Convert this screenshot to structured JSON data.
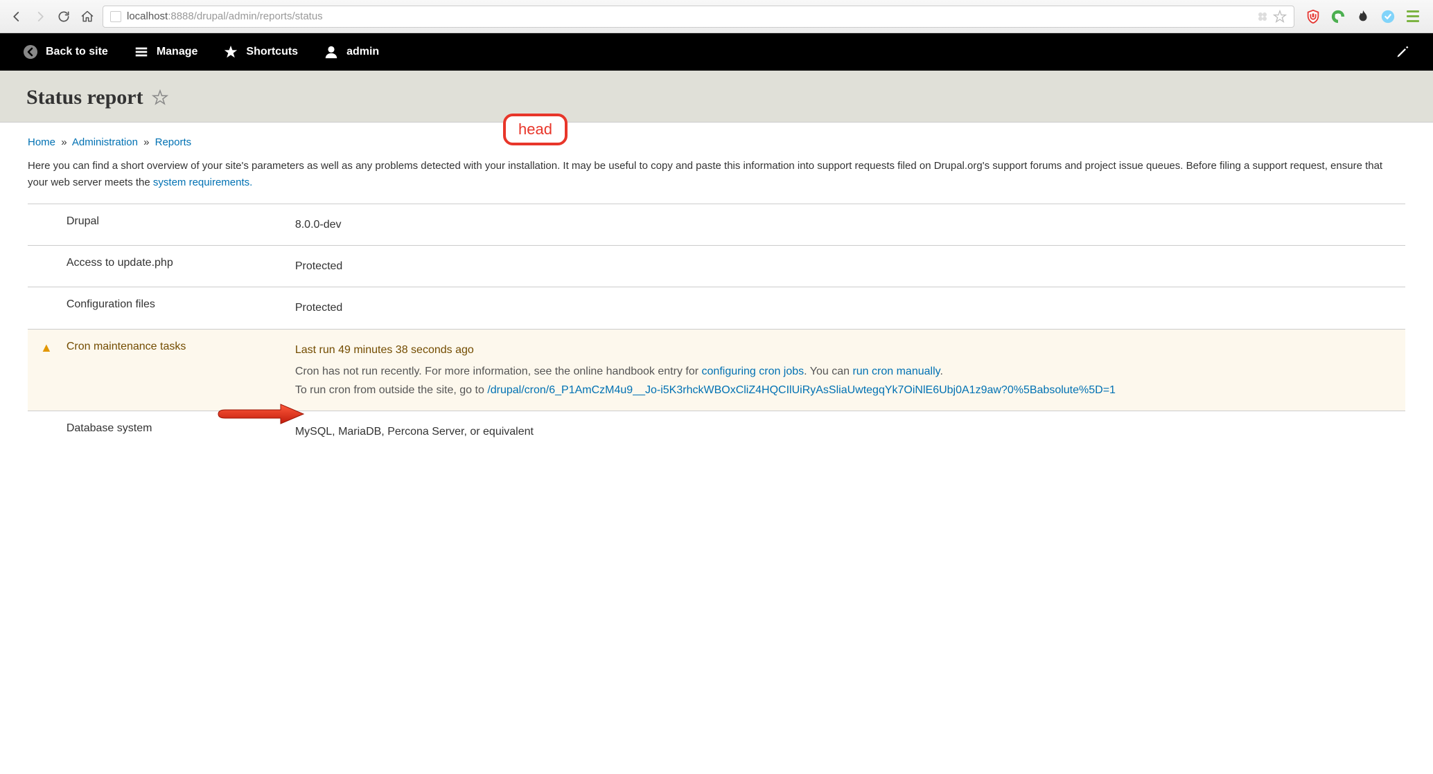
{
  "browser": {
    "url_host": "localhost",
    "url_rest": ":8888/drupal/admin/reports/status"
  },
  "toolbar": {
    "back_to_site": "Back to site",
    "manage": "Manage",
    "shortcuts": "Shortcuts",
    "user": "admin"
  },
  "page": {
    "title": "Status report"
  },
  "breadcrumb": {
    "home": "Home",
    "administration": "Administration",
    "reports": "Reports",
    "sep": "»"
  },
  "intro": {
    "text_pre": "Here you can find a short overview of your site's parameters as well as any problems detected with your installation. It may be useful to copy and paste this information into support requests filed on Drupal.org's support forums and project issue queues. Before filing a support request, ensure that your web server meets the ",
    "link": "system requirements.",
    "text_post": ""
  },
  "rows": {
    "drupal": {
      "label": "Drupal",
      "value": "8.0.0-dev"
    },
    "update": {
      "label": "Access to update.php",
      "value": "Protected"
    },
    "config": {
      "label": "Configuration files",
      "value": "Protected"
    },
    "cron": {
      "label": "Cron maintenance tasks",
      "warn_title": "Last run 49 minutes 38 seconds ago",
      "t1": "Cron has not run recently. For more information, see the online handbook entry for ",
      "link1": "configuring cron jobs",
      "t2": ". You can ",
      "link2": "run cron manually",
      "t3": ".",
      "t4": "To run cron from outside the site, go to ",
      "link3": "/drupal/cron/6_P1AmCzM4u9__Jo-i5K3rhckWBOxCliZ4HQCIlUiRyAsSliaUwtegqYk7OiNlE6Ubj0A1z9aw?0%5Babsolute%5D=1"
    },
    "db": {
      "label": "Database system",
      "value": "MySQL, MariaDB, Percona Server, or equivalent"
    }
  },
  "annotation": {
    "badge": "head"
  }
}
